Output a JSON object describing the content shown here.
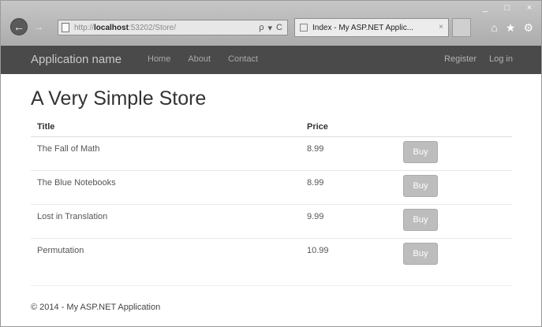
{
  "browser": {
    "window_controls": [
      "_",
      "□",
      "×"
    ],
    "address": {
      "protocol": "http://",
      "host": "localhost",
      "rest": ":53202/Store/",
      "search_label": "ρ",
      "dropdown_label": "▾",
      "refresh_label": "C"
    },
    "tab": {
      "title": "Index - My ASP.NET Applic...",
      "close_label": "×"
    },
    "tool_icons": [
      "home-icon",
      "star-icon",
      "gear-icon"
    ]
  },
  "navbar": {
    "brand": "Application name",
    "links": [
      "Home",
      "About",
      "Contact"
    ],
    "right_links": [
      "Register",
      "Log in"
    ]
  },
  "page": {
    "title": "A Very Simple Store",
    "columns": [
      "Title",
      "Price"
    ],
    "rows": [
      {
        "title": "The Fall of Math",
        "price": "8.99",
        "action": "Buy"
      },
      {
        "title": "The Blue Notebooks",
        "price": "8.99",
        "action": "Buy"
      },
      {
        "title": "Lost in Translation",
        "price": "9.99",
        "action": "Buy"
      },
      {
        "title": "Permutation",
        "price": "10.99",
        "action": "Buy"
      }
    ],
    "footer": "© 2014 - My ASP.NET Application"
  }
}
